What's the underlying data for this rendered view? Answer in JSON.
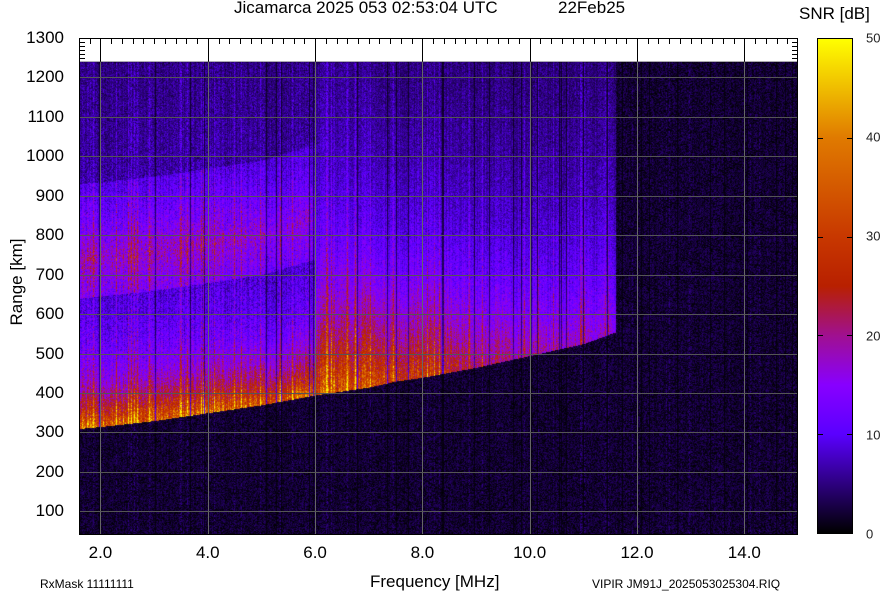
{
  "header": {
    "title": "Jicamarca 2025 053 02:53:04 UTC",
    "date": "22Feb25"
  },
  "footer": {
    "rxmask": "RxMask 11111111",
    "filename": "VIPIR  JM91J_2025053025304.RIQ"
  },
  "chart_data": {
    "type": "heatmap",
    "title": "Jicamarca 2025 053 02:53:04 UTC",
    "xlabel": "Frequency [MHz]",
    "ylabel": "Range [km]",
    "colorbar_label": "SNR [dB]",
    "xlim": [
      1.6,
      15.0
    ],
    "ylim": [
      40,
      1300
    ],
    "data_top_range_km": 1240,
    "clim": [
      0,
      50
    ],
    "x_ticks": [
      "2.0",
      "4.0",
      "6.0",
      "8.0",
      "10.0",
      "12.0",
      "14.0"
    ],
    "x_tick_values": [
      2,
      4,
      6,
      8,
      10,
      12,
      14
    ],
    "y_ticks": [
      "100",
      "200",
      "300",
      "400",
      "500",
      "600",
      "700",
      "800",
      "900",
      "1000",
      "1100",
      "1200",
      "1300"
    ],
    "y_tick_values": [
      100,
      200,
      300,
      400,
      500,
      600,
      700,
      800,
      900,
      1000,
      1100,
      1200,
      1300
    ],
    "colorbar_ticks": [
      "0",
      "10",
      "20",
      "30",
      "40",
      "50"
    ],
    "colorbar_tick_values": [
      0,
      10,
      20,
      30,
      40,
      50
    ],
    "colormap": [
      [
        0,
        "#000000"
      ],
      [
        10,
        "#5a00ff"
      ],
      [
        15,
        "#8800ff"
      ],
      [
        20,
        "#a01090"
      ],
      [
        25,
        "#b82000"
      ],
      [
        30,
        "#c83800"
      ],
      [
        40,
        "#e07a00"
      ],
      [
        50,
        "#ffff00"
      ]
    ],
    "grid": true,
    "echo_trace": {
      "name": "F-region echo (lower edge)",
      "freq_mhz": [
        1.6,
        2.0,
        3.0,
        4.0,
        5.0,
        6.0,
        6.5,
        7.0,
        7.5,
        8.0,
        9.0,
        10.0,
        11.0,
        11.6
      ],
      "virtual_range_km": [
        310,
        315,
        330,
        350,
        370,
        395,
        405,
        415,
        430,
        440,
        465,
        495,
        525,
        555
      ],
      "peak_snr_db": [
        32,
        32,
        31,
        30,
        30,
        29,
        30,
        30,
        26,
        26,
        18,
        14,
        12,
        10
      ]
    },
    "second_hop": {
      "freq_mhz": [
        1.6,
        3.0,
        5.0,
        6.0
      ],
      "virtual_range_km": [
        680,
        700,
        740,
        780
      ],
      "peak_snr_db": [
        14,
        14,
        12,
        10
      ]
    },
    "noise_floor_db": 3
  }
}
